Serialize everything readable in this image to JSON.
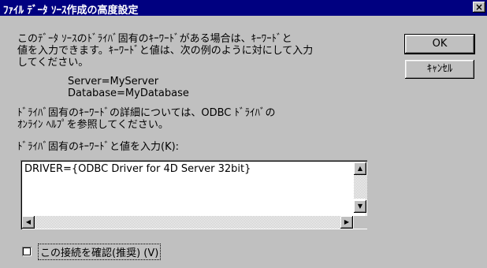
{
  "window": {
    "title": "ﾌｧｲﾙ ﾃﾞｰﾀ ｿｰｽ作成の高度設定",
    "close_label": "×"
  },
  "description": {
    "line1": "このﾃﾞｰﾀ ｿｰｽのﾄﾞﾗｲﾊﾞ固有のｷｰﾜｰﾄﾞがある場合は、ｷｰﾜｰﾄﾞと",
    "line2": "値を入力できます。ｷｰﾜｰﾄﾞと値は、次の例のように対にして入力",
    "line3": "してください。",
    "example1": "Server=MyServer",
    "example2": "Database=MyDatabase",
    "line4": "ﾄﾞﾗｲﾊﾞ固有のｷｰﾜｰﾄﾞの詳細については、ODBC ﾄﾞﾗｲﾊﾞの",
    "line5": "ｵﾝﾗｲﾝ ﾍﾙﾌﾟを参照してください。"
  },
  "keywords": {
    "label": "ﾄﾞﾗｲﾊﾞ固有のｷｰﾜｰﾄﾞと値を入力(K):",
    "value": "DRIVER={ODBC Driver for 4D Server 32bit}"
  },
  "buttons": {
    "ok": "OK",
    "cancel": "ｷｬﾝｾﾙ"
  },
  "verify": {
    "label": "この接続を確認(推奨) (V)",
    "checked": false
  },
  "icons": {
    "scroll_up": "▲",
    "scroll_down": "▼",
    "scroll_left": "◀",
    "scroll_right": "▶"
  }
}
